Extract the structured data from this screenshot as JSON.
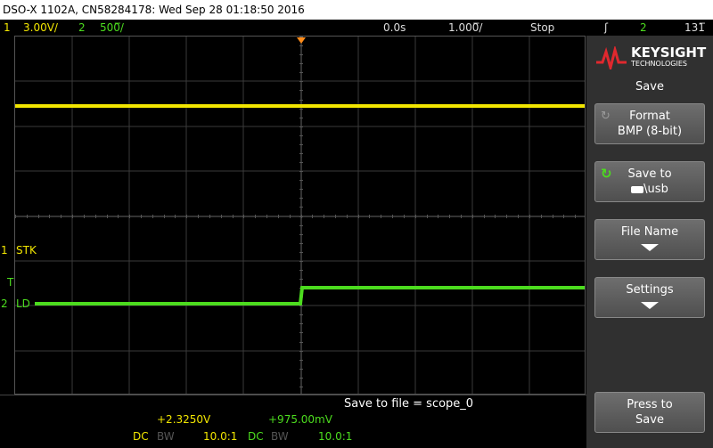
{
  "title": "DSO-X 1102A, CN58284178: Wed Sep 28 01:18:50 2016",
  "status": {
    "ch1_num": "1",
    "ch1_scale": "3.00V/",
    "ch2_num": "2",
    "ch2_scale": "500̅/",
    "time_offset": "0.0s",
    "timebase": "1.000̅/",
    "run_state": "Stop",
    "trigger_icon": "ʃ",
    "trig_ch": "2",
    "trig_level": "131̅"
  },
  "channel_labels": {
    "ch1_marker": "1",
    "ch1_name": "STK",
    "trig_marker": "T",
    "ch2_marker": "2",
    "ch2_name": "LD"
  },
  "panel": {
    "brand": "KEYSIGHT",
    "brand_sub": "TECHNOLOGIES",
    "menu_title": "Save",
    "format_label": "Format",
    "format_value": "BMP (8-bit)",
    "save_to_label": "Save to",
    "save_to_value": "\\usb",
    "file_name_label": "File Name",
    "settings_label": "Settings",
    "press_to_save_l1": "Press to",
    "press_to_save_l2": "Save"
  },
  "message": "Save to file =  scope_0",
  "measurements": {
    "ch1_value": "+2.3250V",
    "ch2_value": "+975.00mV",
    "ch1_coupling": "DC",
    "ch1_bw": "BW",
    "ch1_probe": "10.0:1",
    "ch2_coupling": "DC",
    "ch2_bw": "BW",
    "ch2_probe": "10.0:1"
  },
  "colors": {
    "ch1": "#f2e600",
    "ch2": "#4cdc1e",
    "trigger": "#ff8c1a"
  }
}
